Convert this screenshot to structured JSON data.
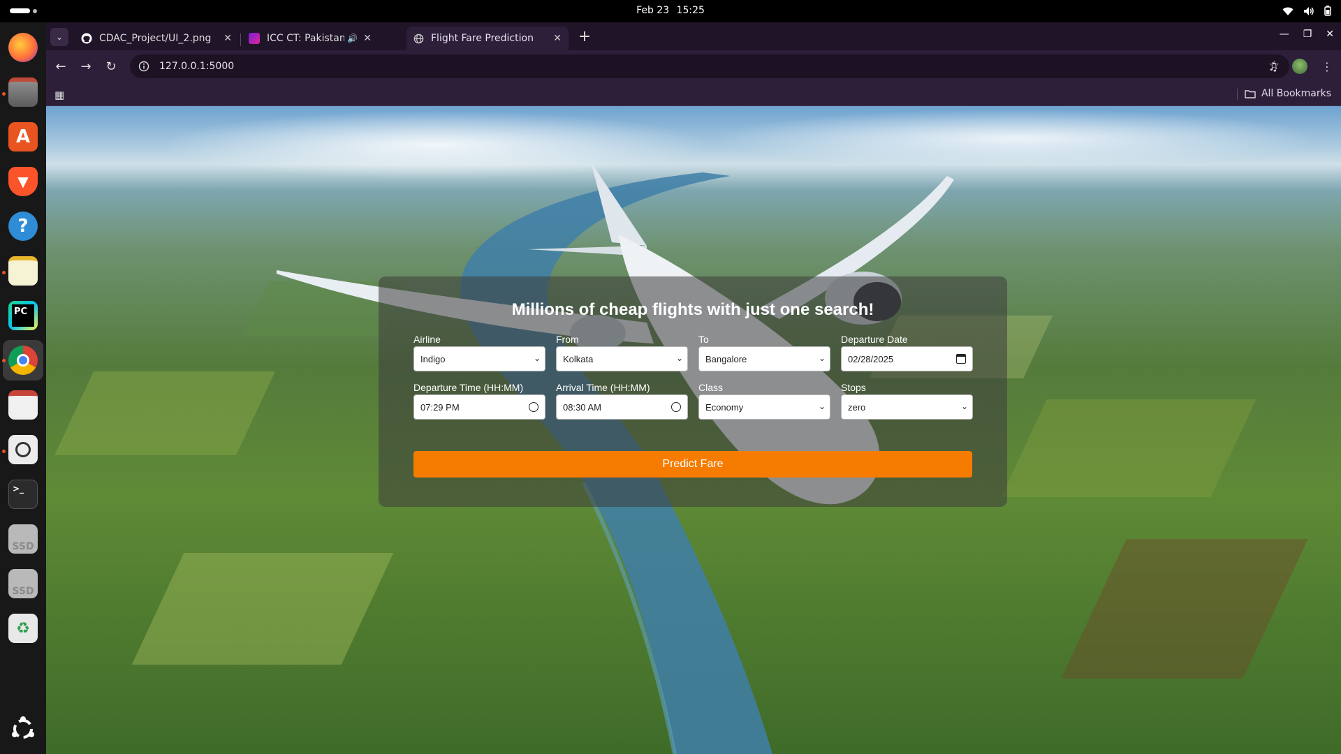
{
  "topbar": {
    "date": "Feb 23",
    "time": "15:25"
  },
  "dock": {
    "items": [
      {
        "name": "firefox",
        "icon": "firefox-icon"
      },
      {
        "name": "files",
        "icon": "files-icon"
      },
      {
        "name": "app-center",
        "icon": "app-center-icon"
      },
      {
        "name": "brave",
        "icon": "brave-icon"
      },
      {
        "name": "help",
        "icon": "help-icon"
      },
      {
        "name": "text-editor",
        "icon": "text-editor-icon"
      },
      {
        "name": "pycharm",
        "icon": "pycharm-icon",
        "label": "PC"
      },
      {
        "name": "chrome",
        "icon": "chrome-icon"
      },
      {
        "name": "document-viewer",
        "icon": "document-viewer-icon"
      },
      {
        "name": "image-viewer",
        "icon": "magnifier-icon"
      },
      {
        "name": "terminal",
        "icon": "terminal-icon",
        "label": ">_"
      },
      {
        "name": "ssd-1",
        "icon": "drive-icon",
        "label": "SSD"
      },
      {
        "name": "ssd-2",
        "icon": "drive-icon",
        "label": "SSD"
      },
      {
        "name": "trash",
        "icon": "trash-icon"
      },
      {
        "name": "show-apps",
        "icon": "ubuntu-icon"
      }
    ]
  },
  "browser": {
    "tabs": [
      {
        "title": "CDAC_Project/UI_2.png",
        "icon": "github-icon",
        "active": false
      },
      {
        "title": "ICC CT: Pakistan vs Inc",
        "icon": "icc-icon",
        "active": false,
        "audio": true
      },
      {
        "title": "Flight Fare Prediction",
        "icon": "globe-icon",
        "active": true
      }
    ],
    "url": "127.0.0.1:5000",
    "bookmarks_label": "All Bookmarks"
  },
  "form": {
    "title": "Millions of cheap flights with just one search!",
    "fields": {
      "airline": {
        "label": "Airline",
        "value": "Indigo"
      },
      "from": {
        "label": "From",
        "value": "Kolkata"
      },
      "to": {
        "label": "To",
        "value": "Bangalore"
      },
      "departure_date": {
        "label": "Departure Date",
        "value": "02/28/2025"
      },
      "departure_time": {
        "label": "Departure Time (HH:MM)",
        "value": "07:29 PM"
      },
      "arrival_time": {
        "label": "Arrival Time (HH:MM)",
        "value": "08:30 AM"
      },
      "class": {
        "label": "Class",
        "value": "Economy"
      },
      "stops": {
        "label": "Stops",
        "value": "zero"
      }
    },
    "submit_label": "Predict Fare"
  },
  "colors": {
    "predict_button": "#f57c00",
    "browser_frame": "#2d1f3a",
    "dock_background": "#181818"
  }
}
